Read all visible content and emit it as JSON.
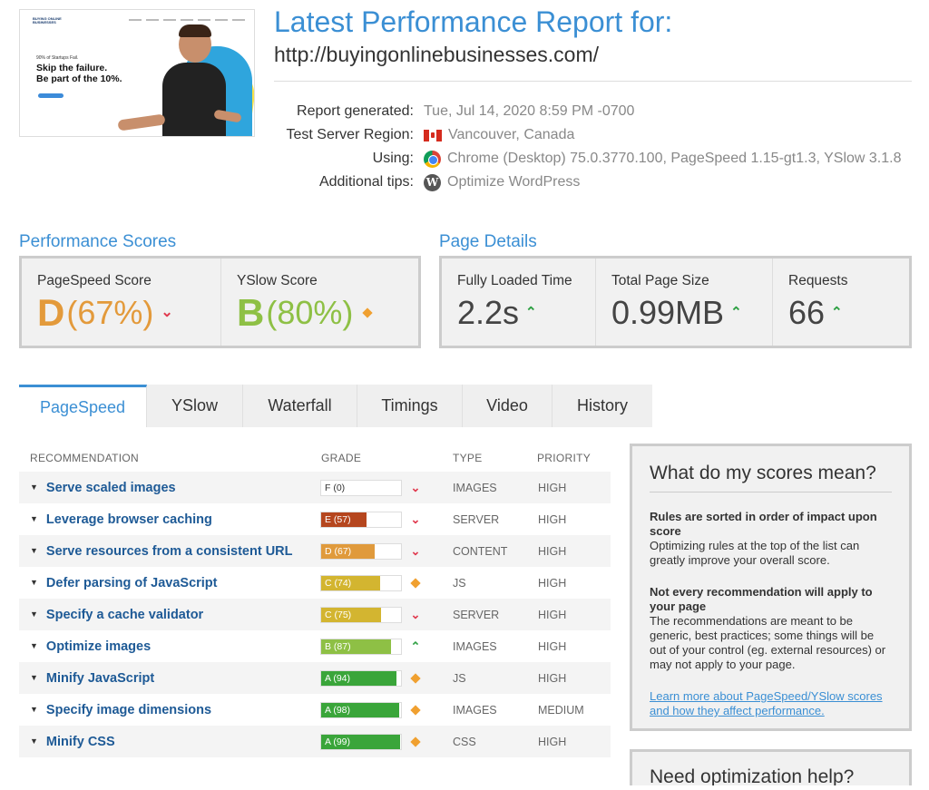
{
  "thumbnail": {
    "logo_text": "BUYING ONLINE BUSINESSES",
    "small_text": "90% of Startups Fail.",
    "headline_1": "Skip the failure.",
    "headline_2": "Be part of the 10%."
  },
  "header": {
    "title": "Latest Performance Report for:",
    "url": "http://buyingonlinebusinesses.com/"
  },
  "meta": {
    "generated_label": "Report generated:",
    "generated_value": "Tue, Jul 14, 2020 8:59 PM -0700",
    "region_label": "Test Server Region:",
    "region_value": "Vancouver, Canada",
    "using_label": "Using:",
    "using_value": "Chrome (Desktop) 75.0.3770.100, PageSpeed 1.15-gt1.3, YSlow 3.1.8",
    "tips_label": "Additional tips:",
    "tips_value": "Optimize WordPress"
  },
  "scores": {
    "section_title": "Performance Scores",
    "pagespeed_label": "PageSpeed Score",
    "pagespeed_grade": "D",
    "pagespeed_pct": "(67%)",
    "yslow_label": "YSlow Score",
    "yslow_grade": "B",
    "yslow_pct": "(80%)"
  },
  "details": {
    "section_title": "Page Details",
    "loaded_label": "Fully Loaded Time",
    "loaded_value": "2.2s",
    "size_label": "Total Page Size",
    "size_value": "0.99MB",
    "requests_label": "Requests",
    "requests_value": "66"
  },
  "tabs": [
    "PageSpeed",
    "YSlow",
    "Waterfall",
    "Timings",
    "Video",
    "History"
  ],
  "table": {
    "headers": {
      "recommendation": "RECOMMENDATION",
      "grade": "GRADE",
      "type": "TYPE",
      "priority": "PRIORITY"
    },
    "rows": [
      {
        "name": "Serve scaled images",
        "grade": "F (0)",
        "score": 0,
        "color": "#ffffff",
        "text_color": "#333333",
        "trend": "down",
        "type": "IMAGES",
        "priority": "HIGH"
      },
      {
        "name": "Leverage browser caching",
        "grade": "E (57)",
        "score": 57,
        "color": "#b5461e",
        "text_color": "#ffffff",
        "trend": "down",
        "type": "SERVER",
        "priority": "HIGH"
      },
      {
        "name": "Serve resources from a consistent URL",
        "grade": "D (67)",
        "score": 67,
        "color": "#e09a3c",
        "text_color": "#ffffff",
        "trend": "down",
        "type": "CONTENT",
        "priority": "HIGH"
      },
      {
        "name": "Defer parsing of JavaScript",
        "grade": "C (74)",
        "score": 74,
        "color": "#d3b530",
        "text_color": "#ffffff",
        "trend": "neutral",
        "type": "JS",
        "priority": "HIGH"
      },
      {
        "name": "Specify a cache validator",
        "grade": "C (75)",
        "score": 75,
        "color": "#d3b530",
        "text_color": "#ffffff",
        "trend": "down",
        "type": "SERVER",
        "priority": "HIGH"
      },
      {
        "name": "Optimize images",
        "grade": "B (87)",
        "score": 87,
        "color": "#8ec045",
        "text_color": "#ffffff",
        "trend": "up",
        "type": "IMAGES",
        "priority": "HIGH"
      },
      {
        "name": "Minify JavaScript",
        "grade": "A (94)",
        "score": 94,
        "color": "#3aa53a",
        "text_color": "#ffffff",
        "trend": "neutral",
        "type": "JS",
        "priority": "HIGH"
      },
      {
        "name": "Specify image dimensions",
        "grade": "A (98)",
        "score": 98,
        "color": "#3aa53a",
        "text_color": "#ffffff",
        "trend": "neutral",
        "type": "IMAGES",
        "priority": "MEDIUM"
      },
      {
        "name": "Minify CSS",
        "grade": "A (99)",
        "score": 99,
        "color": "#3aa53a",
        "text_color": "#ffffff",
        "trend": "neutral",
        "type": "CSS",
        "priority": "HIGH"
      }
    ]
  },
  "sidebar": {
    "title": "What do my scores mean?",
    "block1_bold": "Rules are sorted in order of impact upon score",
    "block1_text": "Optimizing rules at the top of the list can greatly improve your overall score.",
    "block2_bold": "Not every recommendation will apply to your page",
    "block2_text": "The recommendations are meant to be generic, best practices; some things will be out of your control (eg. external resources) or may not apply to your page.",
    "link": "Learn more about PageSpeed/YSlow scores and how they affect performance.",
    "next_title": "Need optimization help?"
  },
  "colors": {
    "accent": "#3b8fd4",
    "grade_d": "#e39a3b",
    "grade_b": "#8ec045"
  }
}
